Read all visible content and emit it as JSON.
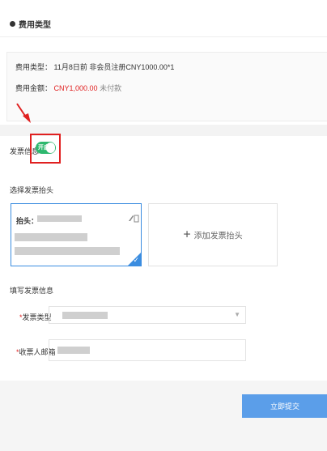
{
  "section": {
    "title": "费用类型"
  },
  "fee": {
    "type_label": "费用类型：",
    "type_value": "11月8日前 非会员注册CNY1000.00*1",
    "amount_label": "费用金额：",
    "amount_value": "CNY1,000.00",
    "status": "未付款"
  },
  "invoice": {
    "label": "发票信息",
    "toggle_text": "开启",
    "toggle_on": true,
    "select_header_label": "选择发票抬头",
    "card": {
      "title_label": "抬头："
    },
    "add_header_label": "添加发票抬头",
    "fill_label": "填写发票信息",
    "type_field_label": "发票类型",
    "email_field_label": "收票人邮箱"
  },
  "submit_label": "立即提交",
  "colors": {
    "accent": "#3b8de0",
    "toggle": "#2eb86e",
    "price": "#e02020",
    "submit": "#5b9ee9"
  }
}
